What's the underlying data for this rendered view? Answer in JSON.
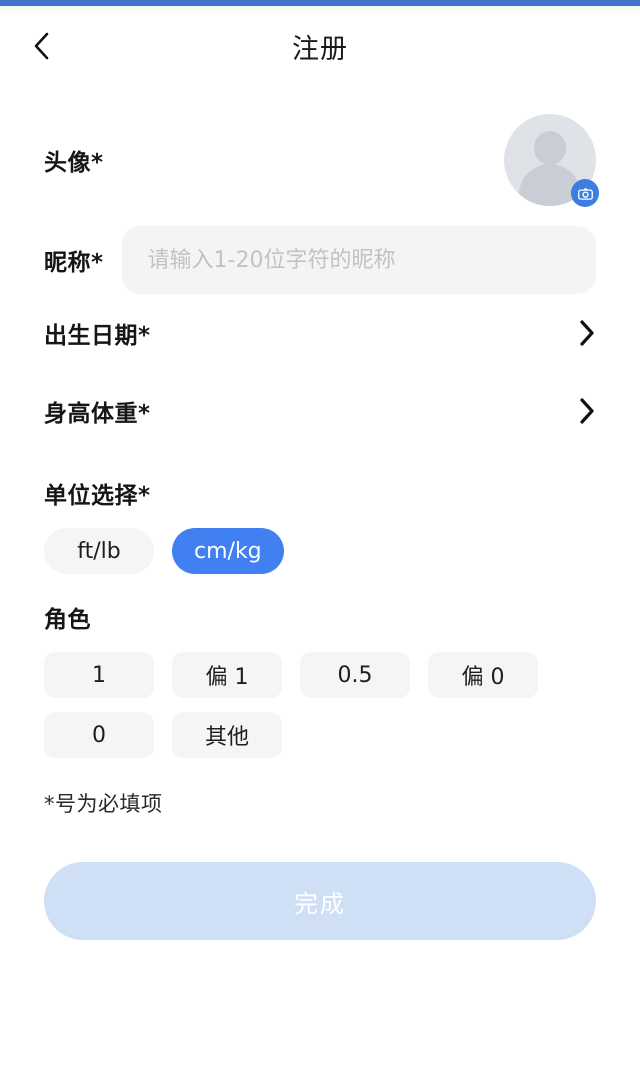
{
  "header": {
    "title": "注册",
    "back_icon": "chevron-left-icon"
  },
  "avatar": {
    "label": "头像*",
    "camera_icon": "camera-icon"
  },
  "nickname": {
    "label": "昵称*",
    "value": "",
    "placeholder": "请输入1-20位字符的昵称"
  },
  "nav_rows": [
    {
      "label": "出生日期*",
      "chevron": "chevron-right-icon"
    },
    {
      "label": "身高体重*",
      "chevron": "chevron-right-icon"
    }
  ],
  "unit_section": {
    "label": "单位选择*",
    "options": [
      {
        "label": "ft/lb",
        "selected": false
      },
      {
        "label": "cm/kg",
        "selected": true
      }
    ]
  },
  "role_section": {
    "label": "角色",
    "options": [
      {
        "label": "1",
        "selected": false
      },
      {
        "label": "偏 1",
        "selected": false
      },
      {
        "label": "0.5",
        "selected": false
      },
      {
        "label": "偏 0",
        "selected": false
      },
      {
        "label": "0",
        "selected": false
      },
      {
        "label": "其他",
        "selected": false
      }
    ]
  },
  "footnote": "*号为必填项",
  "submit": {
    "label": "完成"
  },
  "colors": {
    "accent": "#4080f0",
    "status_bar": "#3f72c8",
    "chip_idle": "#f5f5f6",
    "submit_disabled": "#cfdff5"
  }
}
